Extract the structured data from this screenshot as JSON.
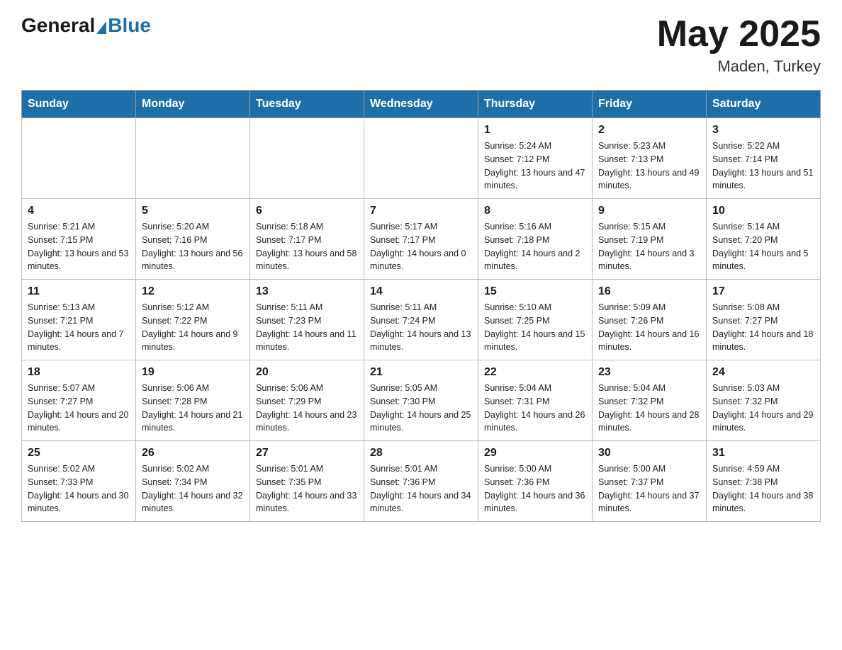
{
  "header": {
    "logo_general": "General",
    "logo_blue": "Blue",
    "month_year": "May 2025",
    "location": "Maden, Turkey"
  },
  "days_of_week": [
    "Sunday",
    "Monday",
    "Tuesday",
    "Wednesday",
    "Thursday",
    "Friday",
    "Saturday"
  ],
  "weeks": [
    [
      {
        "day": "",
        "info": ""
      },
      {
        "day": "",
        "info": ""
      },
      {
        "day": "",
        "info": ""
      },
      {
        "day": "",
        "info": ""
      },
      {
        "day": "1",
        "info": "Sunrise: 5:24 AM\nSunset: 7:12 PM\nDaylight: 13 hours and 47 minutes."
      },
      {
        "day": "2",
        "info": "Sunrise: 5:23 AM\nSunset: 7:13 PM\nDaylight: 13 hours and 49 minutes."
      },
      {
        "day": "3",
        "info": "Sunrise: 5:22 AM\nSunset: 7:14 PM\nDaylight: 13 hours and 51 minutes."
      }
    ],
    [
      {
        "day": "4",
        "info": "Sunrise: 5:21 AM\nSunset: 7:15 PM\nDaylight: 13 hours and 53 minutes."
      },
      {
        "day": "5",
        "info": "Sunrise: 5:20 AM\nSunset: 7:16 PM\nDaylight: 13 hours and 56 minutes."
      },
      {
        "day": "6",
        "info": "Sunrise: 5:18 AM\nSunset: 7:17 PM\nDaylight: 13 hours and 58 minutes."
      },
      {
        "day": "7",
        "info": "Sunrise: 5:17 AM\nSunset: 7:17 PM\nDaylight: 14 hours and 0 minutes."
      },
      {
        "day": "8",
        "info": "Sunrise: 5:16 AM\nSunset: 7:18 PM\nDaylight: 14 hours and 2 minutes."
      },
      {
        "day": "9",
        "info": "Sunrise: 5:15 AM\nSunset: 7:19 PM\nDaylight: 14 hours and 3 minutes."
      },
      {
        "day": "10",
        "info": "Sunrise: 5:14 AM\nSunset: 7:20 PM\nDaylight: 14 hours and 5 minutes."
      }
    ],
    [
      {
        "day": "11",
        "info": "Sunrise: 5:13 AM\nSunset: 7:21 PM\nDaylight: 14 hours and 7 minutes."
      },
      {
        "day": "12",
        "info": "Sunrise: 5:12 AM\nSunset: 7:22 PM\nDaylight: 14 hours and 9 minutes."
      },
      {
        "day": "13",
        "info": "Sunrise: 5:11 AM\nSunset: 7:23 PM\nDaylight: 14 hours and 11 minutes."
      },
      {
        "day": "14",
        "info": "Sunrise: 5:11 AM\nSunset: 7:24 PM\nDaylight: 14 hours and 13 minutes."
      },
      {
        "day": "15",
        "info": "Sunrise: 5:10 AM\nSunset: 7:25 PM\nDaylight: 14 hours and 15 minutes."
      },
      {
        "day": "16",
        "info": "Sunrise: 5:09 AM\nSunset: 7:26 PM\nDaylight: 14 hours and 16 minutes."
      },
      {
        "day": "17",
        "info": "Sunrise: 5:08 AM\nSunset: 7:27 PM\nDaylight: 14 hours and 18 minutes."
      }
    ],
    [
      {
        "day": "18",
        "info": "Sunrise: 5:07 AM\nSunset: 7:27 PM\nDaylight: 14 hours and 20 minutes."
      },
      {
        "day": "19",
        "info": "Sunrise: 5:06 AM\nSunset: 7:28 PM\nDaylight: 14 hours and 21 minutes."
      },
      {
        "day": "20",
        "info": "Sunrise: 5:06 AM\nSunset: 7:29 PM\nDaylight: 14 hours and 23 minutes."
      },
      {
        "day": "21",
        "info": "Sunrise: 5:05 AM\nSunset: 7:30 PM\nDaylight: 14 hours and 25 minutes."
      },
      {
        "day": "22",
        "info": "Sunrise: 5:04 AM\nSunset: 7:31 PM\nDaylight: 14 hours and 26 minutes."
      },
      {
        "day": "23",
        "info": "Sunrise: 5:04 AM\nSunset: 7:32 PM\nDaylight: 14 hours and 28 minutes."
      },
      {
        "day": "24",
        "info": "Sunrise: 5:03 AM\nSunset: 7:32 PM\nDaylight: 14 hours and 29 minutes."
      }
    ],
    [
      {
        "day": "25",
        "info": "Sunrise: 5:02 AM\nSunset: 7:33 PM\nDaylight: 14 hours and 30 minutes."
      },
      {
        "day": "26",
        "info": "Sunrise: 5:02 AM\nSunset: 7:34 PM\nDaylight: 14 hours and 32 minutes."
      },
      {
        "day": "27",
        "info": "Sunrise: 5:01 AM\nSunset: 7:35 PM\nDaylight: 14 hours and 33 minutes."
      },
      {
        "day": "28",
        "info": "Sunrise: 5:01 AM\nSunset: 7:36 PM\nDaylight: 14 hours and 34 minutes."
      },
      {
        "day": "29",
        "info": "Sunrise: 5:00 AM\nSunset: 7:36 PM\nDaylight: 14 hours and 36 minutes."
      },
      {
        "day": "30",
        "info": "Sunrise: 5:00 AM\nSunset: 7:37 PM\nDaylight: 14 hours and 37 minutes."
      },
      {
        "day": "31",
        "info": "Sunrise: 4:59 AM\nSunset: 7:38 PM\nDaylight: 14 hours and 38 minutes."
      }
    ]
  ]
}
